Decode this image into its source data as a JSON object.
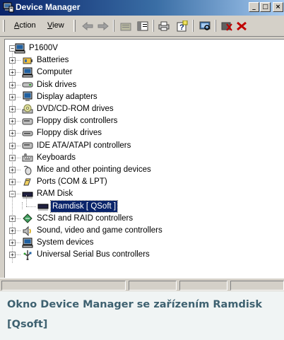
{
  "window": {
    "title": "Device Manager",
    "caption_buttons": [
      "_",
      "□",
      "×"
    ]
  },
  "menu": {
    "items": [
      {
        "prefix": "",
        "accel": "A",
        "rest": "ction"
      },
      {
        "prefix": "",
        "accel": "V",
        "rest": "iew"
      }
    ]
  },
  "toolbar": {
    "icons": [
      "back-arrow-icon",
      "forward-arrow-icon",
      "up-folder-icon",
      "properties-panel-icon",
      "print-icon",
      "help-icon",
      "scan-hardware-icon",
      "disable-device-icon",
      "uninstall-device-icon"
    ]
  },
  "tree": {
    "root": "P1600V",
    "categories": [
      {
        "label": "Batteries",
        "icon": "battery-icon",
        "state": "collapsed"
      },
      {
        "label": "Computer",
        "icon": "computer-icon",
        "state": "collapsed"
      },
      {
        "label": "Disk drives",
        "icon": "disk-drive-icon",
        "state": "collapsed"
      },
      {
        "label": "Display adapters",
        "icon": "monitor-icon",
        "state": "collapsed"
      },
      {
        "label": "DVD/CD-ROM drives",
        "icon": "cdrom-icon",
        "state": "collapsed"
      },
      {
        "label": "Floppy disk controllers",
        "icon": "floppy-controller-icon",
        "state": "collapsed"
      },
      {
        "label": "Floppy disk drives",
        "icon": "floppy-drive-icon",
        "state": "collapsed"
      },
      {
        "label": "IDE ATA/ATAPI controllers",
        "icon": "ide-controller-icon",
        "state": "collapsed"
      },
      {
        "label": "Keyboards",
        "icon": "keyboard-icon",
        "state": "collapsed"
      },
      {
        "label": "Mice and other pointing devices",
        "icon": "mouse-icon",
        "state": "collapsed"
      },
      {
        "label": "Ports (COM & LPT)",
        "icon": "port-icon",
        "state": "collapsed"
      },
      {
        "label": "RAM Disk",
        "icon": "ram-chip-icon",
        "state": "expanded",
        "children": [
          {
            "label": "Ramdisk [ QSoft ]",
            "icon": "ram-chip-icon",
            "selected": true
          }
        ]
      },
      {
        "label": "SCSI and RAID controllers",
        "icon": "scsi-icon",
        "state": "collapsed"
      },
      {
        "label": "Sound, video and game controllers",
        "icon": "speaker-icon",
        "state": "collapsed"
      },
      {
        "label": "System devices",
        "icon": "system-computer-icon",
        "state": "collapsed"
      },
      {
        "label": "Universal Serial Bus controllers",
        "icon": "usb-icon",
        "state": "collapsed"
      }
    ]
  },
  "caption": {
    "text": "Okno Device Manager se zařízením Ramdisk [Qsoft]"
  }
}
